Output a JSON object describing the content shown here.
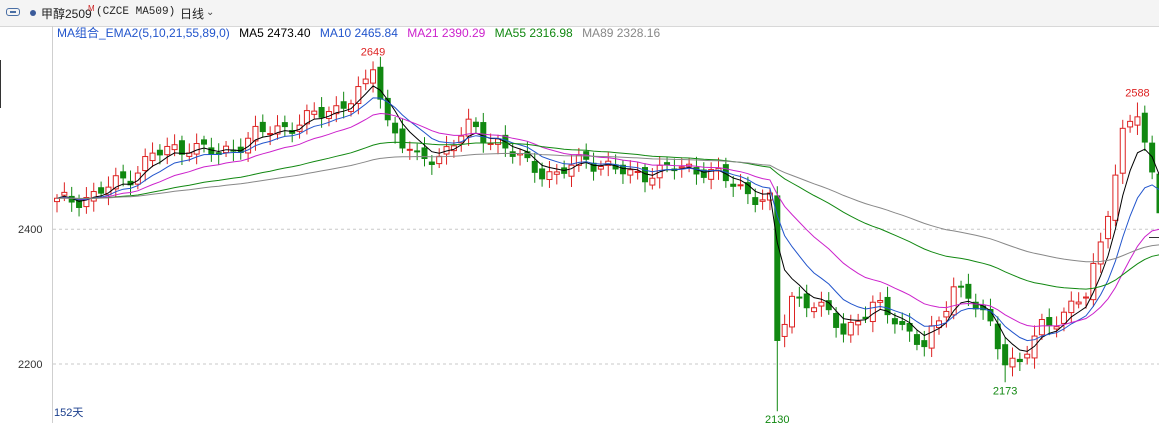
{
  "header": {
    "name": "甲醇2509",
    "sup": "M",
    "code": "(CZCE MA509)",
    "period": "日线",
    "link_icon": "link-icon",
    "dot_icon": "bullet-dot-icon",
    "chevron_icon": "chevron-down-icon"
  },
  "legend": {
    "group": "MA组合_EMA2(5,10,21,55,89,0)",
    "items": [
      {
        "label": "MA5 2473.40",
        "color": "#000000"
      },
      {
        "label": "MA10 2465.84",
        "color": "#2255cc"
      },
      {
        "label": "MA21 2390.29",
        "color": "#cc22cc"
      },
      {
        "label": "MA55 2316.98",
        "color": "#118811"
      },
      {
        "label": "MA89 2328.16",
        "color": "#888888"
      }
    ]
  },
  "footer": {
    "days": "152天"
  },
  "chart_data": {
    "type": "candlestick",
    "bars": 152,
    "ylim": [
      2117,
      2700
    ],
    "y_ticks": [
      2200,
      2400
    ],
    "colors": {
      "up": "#dd2222",
      "down": "#118811"
    },
    "annotations": [
      {
        "text": "2649",
        "bar": 43,
        "price": 2649,
        "color": "#dd2222"
      },
      {
        "text": "2130",
        "bar": 98,
        "price": 2130,
        "color": "#118811"
      },
      {
        "text": "2173",
        "bar": 129,
        "price": 2173,
        "color": "#118811"
      },
      {
        "text": "2588",
        "bar": 147,
        "price": 2588,
        "color": "#dd2222"
      }
    ],
    "anchors": [
      [
        0,
        2440
      ],
      [
        5,
        2450
      ],
      [
        10,
        2480
      ],
      [
        13,
        2510
      ],
      [
        18,
        2525
      ],
      [
        22,
        2510
      ],
      [
        27,
        2540
      ],
      [
        32,
        2555
      ],
      [
        38,
        2580
      ],
      [
        42,
        2610
      ],
      [
        43,
        2640
      ],
      [
        45,
        2560
      ],
      [
        49,
        2500
      ],
      [
        52,
        2510
      ],
      [
        56,
        2550
      ],
      [
        60,
        2530
      ],
      [
        64,
        2495
      ],
      [
        68,
        2480
      ],
      [
        72,
        2505
      ],
      [
        78,
        2480
      ],
      [
        84,
        2490
      ],
      [
        88,
        2490
      ],
      [
        94,
        2455
      ],
      [
        97,
        2440
      ],
      [
        98,
        2230
      ],
      [
        100,
        2300
      ],
      [
        103,
        2290
      ],
      [
        107,
        2250
      ],
      [
        111,
        2285
      ],
      [
        114,
        2270
      ],
      [
        118,
        2225
      ],
      [
        120,
        2260
      ],
      [
        122,
        2320
      ],
      [
        124,
        2300
      ],
      [
        127,
        2255
      ],
      [
        129,
        2210
      ],
      [
        131,
        2200
      ],
      [
        134,
        2255
      ],
      [
        138,
        2285
      ],
      [
        140,
        2300
      ],
      [
        142,
        2380
      ],
      [
        145,
        2540
      ],
      [
        147,
        2570
      ],
      [
        149,
        2480
      ],
      [
        151,
        2390
      ]
    ],
    "ma_series": [
      {
        "name": "MA5",
        "color": "#000000",
        "period": 5,
        "last": 2473.4
      },
      {
        "name": "MA10",
        "color": "#2255cc",
        "period": 10,
        "last": 2465.84
      },
      {
        "name": "MA21",
        "color": "#cc22cc",
        "period": 21,
        "last": 2390.29
      },
      {
        "name": "MA55",
        "color": "#118811",
        "period": 55,
        "last": 2316.98
      },
      {
        "name": "MA89",
        "color": "#888888",
        "period": 89,
        "last": 2328.16
      }
    ]
  }
}
